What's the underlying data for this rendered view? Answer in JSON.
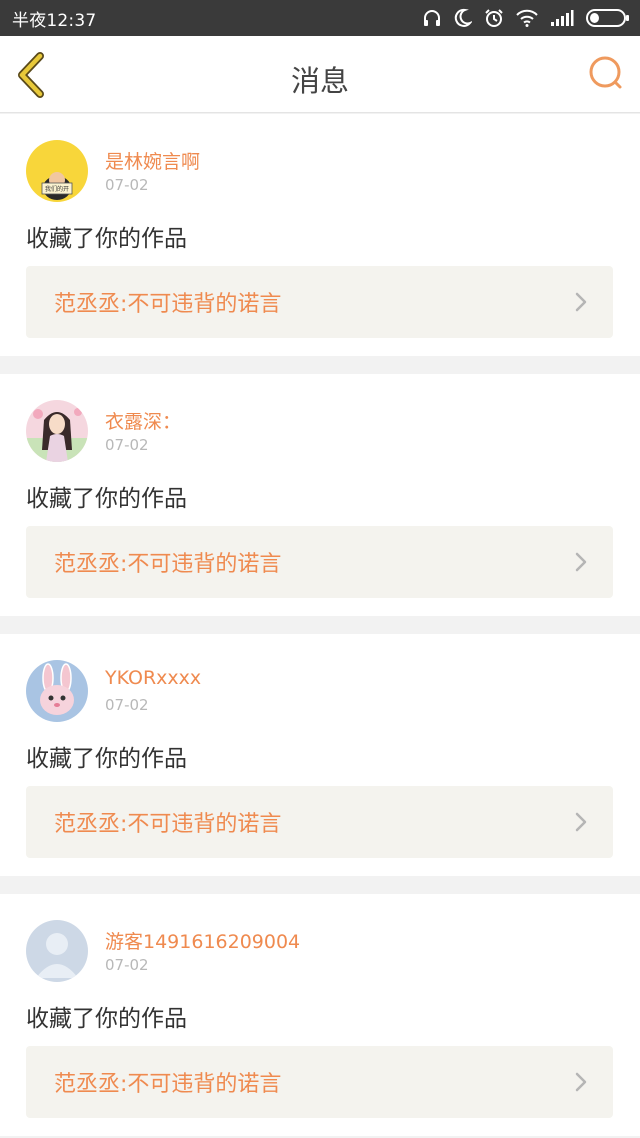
{
  "status_bar": {
    "time": "半夜12:37",
    "icons": [
      "headphones-icon",
      "moon-icon",
      "alarm-icon",
      "wifi-icon",
      "signal-icon",
      "battery-icon"
    ]
  },
  "header": {
    "title": "消息",
    "back_icon": "chevron-left-icon",
    "search_icon": "search-icon"
  },
  "colors": {
    "accent": "#ef8a4f",
    "back_icon": "#e8c93a",
    "status_bar_bg": "#3a3a3a",
    "card_quote_bg": "#f4f3ee"
  },
  "messages": [
    {
      "username": "是林婉言啊",
      "date": "07-02",
      "action": "收藏了你的作品",
      "quote": "范丞丞:不可违背的诺言",
      "avatar": "yellow-avatar",
      "avatar_sign": "我们的开"
    },
    {
      "username": "衣露深：",
      "date": "07-02",
      "action": "收藏了你的作品",
      "quote": "范丞丞:不可违背的诺言",
      "avatar": "anime-girl-avatar"
    },
    {
      "username": "YKORxxxx",
      "date": "07-02",
      "action": "收藏了你的作品",
      "quote": "范丞丞:不可违背的诺言",
      "avatar": "bunny-avatar"
    },
    {
      "username": "游客1491616209004",
      "date": "07-02",
      "action": "收藏了你的作品",
      "quote": "范丞丞:不可违背的诺言",
      "avatar": "default-user-avatar"
    }
  ]
}
